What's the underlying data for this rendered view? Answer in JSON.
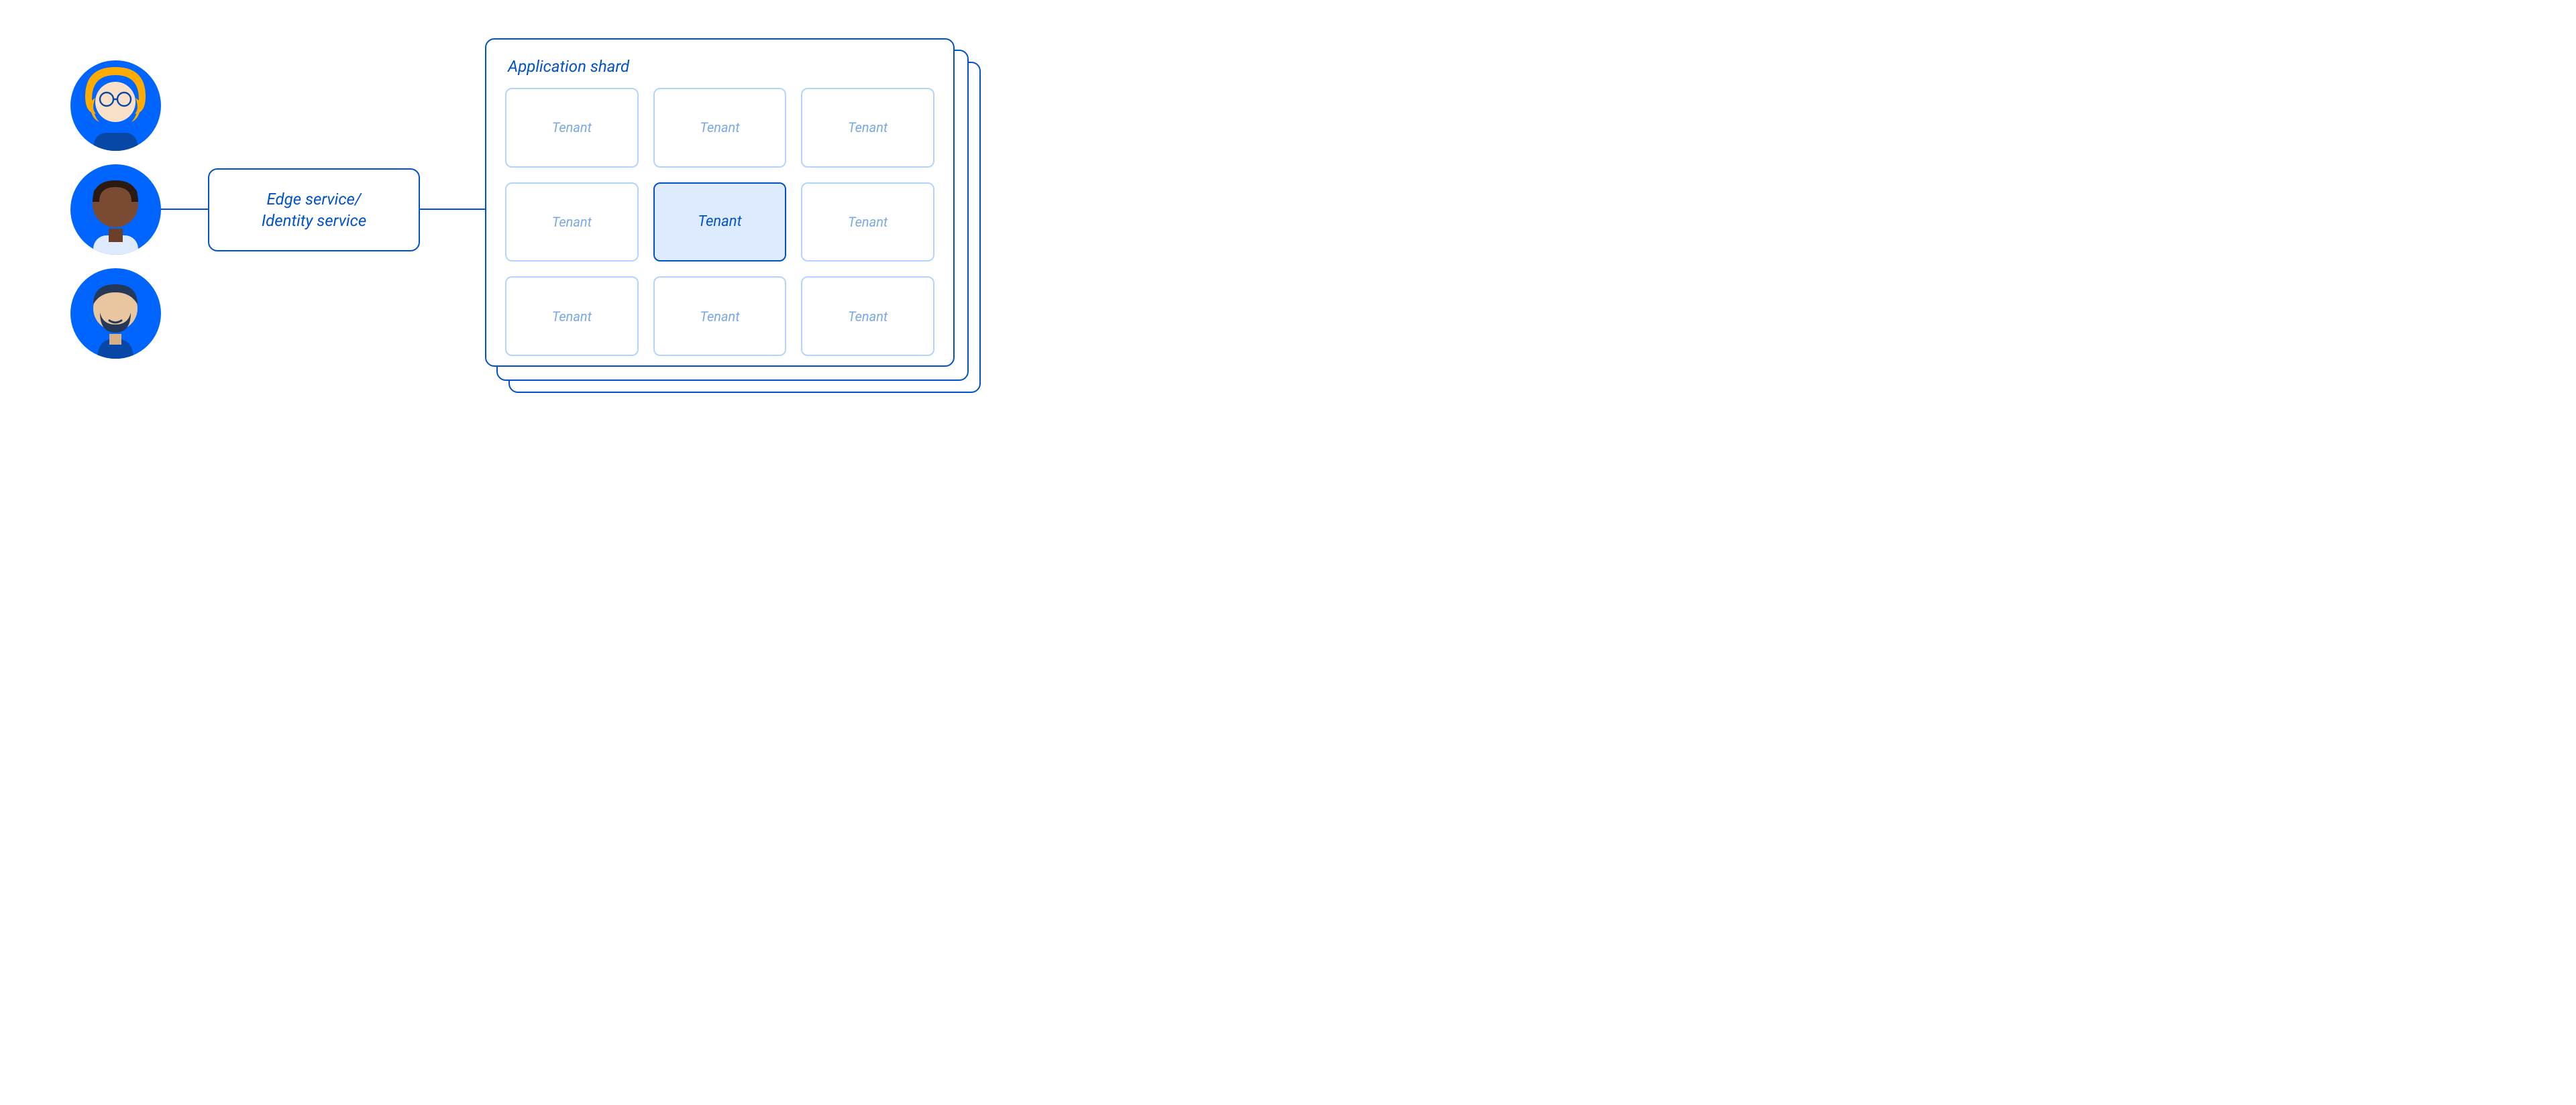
{
  "edge_service": {
    "label_line1": "Edge service/",
    "label_line2": "Identity service"
  },
  "shard": {
    "title": "Application shard",
    "tenants": [
      {
        "label": "Tenant",
        "active": false
      },
      {
        "label": "Tenant",
        "active": false
      },
      {
        "label": "Tenant",
        "active": false
      },
      {
        "label": "Tenant",
        "active": false
      },
      {
        "label": "Tenant",
        "active": true
      },
      {
        "label": "Tenant",
        "active": false
      },
      {
        "label": "Tenant",
        "active": false
      },
      {
        "label": "Tenant",
        "active": false
      },
      {
        "label": "Tenant",
        "active": false
      }
    ]
  },
  "avatars": [
    {
      "name": "user-avatar-1"
    },
    {
      "name": "user-avatar-2"
    },
    {
      "name": "user-avatar-3"
    }
  ]
}
